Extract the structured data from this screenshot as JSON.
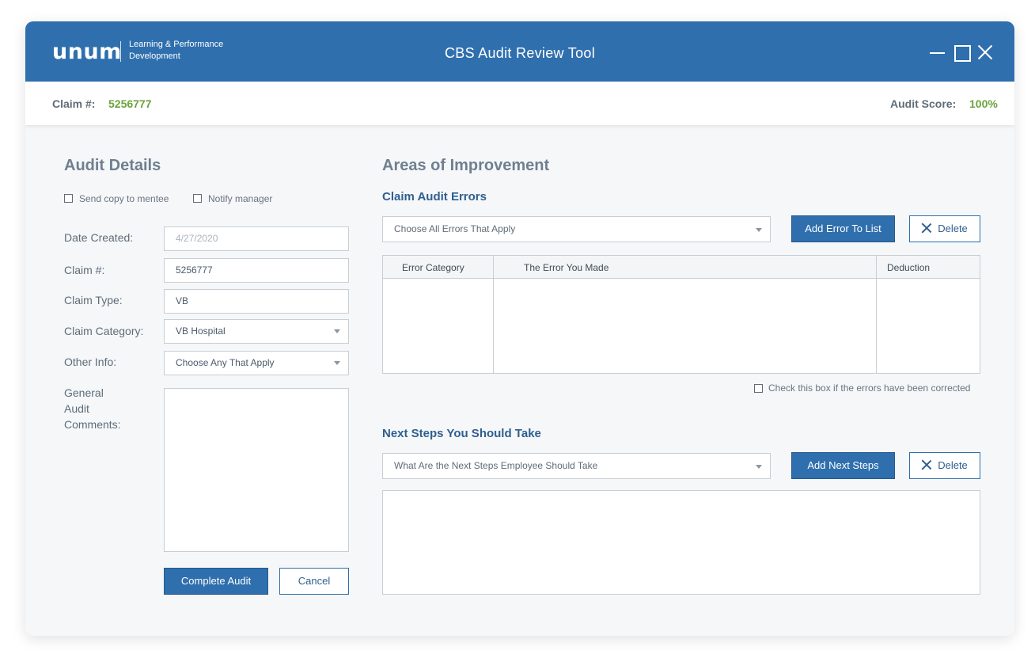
{
  "app": {
    "logo_text": "unum",
    "logo_sub_line1": "Learning & Performance",
    "logo_sub_line2": "Development",
    "title": "CBS Audit Review Tool",
    "window_controls": [
      "minimize-icon",
      "maximize-icon",
      "close-icon"
    ]
  },
  "info_bar": {
    "claim_label": "Claim #:",
    "claim_value": "5256777",
    "score_label": "Audit Score:",
    "score_value": "100%"
  },
  "colors": {
    "brand_blue": "#2f6fad",
    "accent_green": "#6aa33c",
    "heading_dark_blue": "#2f5f8f"
  },
  "audit_details": {
    "heading": "Audit Details",
    "send_copy_label": "Send copy to mentee",
    "notify_manager_label": "Notify manager",
    "date_created_label": "Date Created:",
    "date_created_value": "4/27/2020",
    "claim_number_label": "Claim #:",
    "claim_number_value": "5256777",
    "claim_type_label": "Claim Type:",
    "claim_type_value": "VB",
    "claim_category_label": "Claim Category:",
    "claim_category_value": "VB Hospital",
    "other_info_label": "Other Info:",
    "other_info_value": "Choose Any That Apply",
    "comments_label_line1": "General",
    "comments_label_line2": "Audit",
    "comments_label_line3": "Comments:",
    "comments_value": "",
    "complete_button": "Complete Audit",
    "cancel_button": "Cancel"
  },
  "areas_of_improvement": {
    "heading": "Areas of Improvement",
    "errors_heading": "Claim Audit Errors",
    "errors_select": "Choose All Errors That Apply",
    "add_error_button": "Add Error To List",
    "delete_button": "Delete",
    "table_headers": [
      "Error Category",
      "The Error You Made",
      "Deduction"
    ],
    "table_rows": [],
    "corrected_checkbox_label": "Check this box if the errors have been corrected",
    "next_steps_heading": "Next Steps You Should Take",
    "next_steps_select": "What Are the Next Steps Employee Should Take",
    "add_next_steps_button": "Add Next Steps",
    "delete_button_2": "Delete",
    "next_steps_value": ""
  }
}
